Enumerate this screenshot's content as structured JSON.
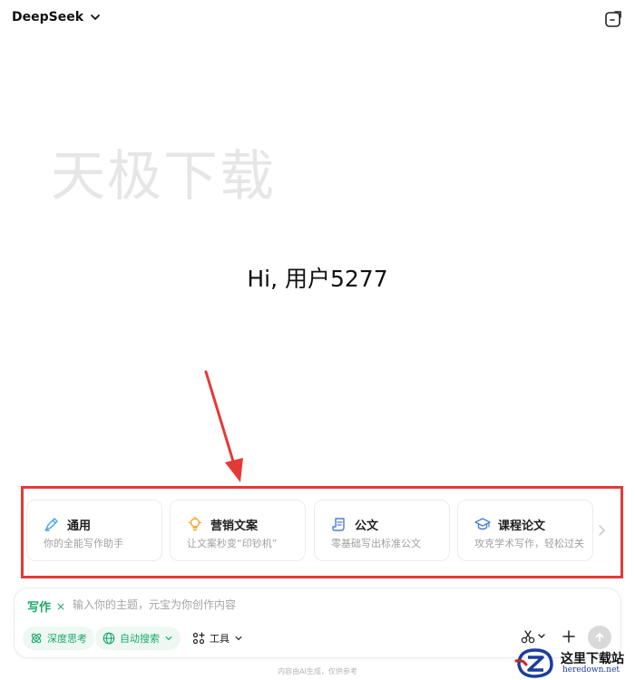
{
  "header": {
    "app_name": "DeepSeek"
  },
  "watermark": "天极下载",
  "greeting": "Hi, 用户5277",
  "cards": [
    {
      "title": "通用",
      "subtitle": "你的全能写作助手",
      "icon": "pen-icon"
    },
    {
      "title": "营销文案",
      "subtitle": "让文案秒变“印钞机”",
      "icon": "lightbulb-icon"
    },
    {
      "title": "公文",
      "subtitle": "零基础写出标准公文",
      "icon": "scroll-icon"
    },
    {
      "title": "课程论文",
      "subtitle": "攻克学术写作，轻松过关",
      "icon": "graduation-cap-icon"
    }
  ],
  "composer": {
    "mode_label": "写作",
    "mode_close": "×",
    "placeholder": "输入你的主题，元宝为你创作内容",
    "value": "",
    "deep_think_label": "深度思考",
    "auto_search_label": "自动搜索",
    "tools_label": "工具"
  },
  "disclaimer": "内容由AI生成，仅供参考",
  "logo": {
    "title": "这里下载站",
    "url": "heredown.net"
  },
  "colors": {
    "accent_green": "#1aa86b",
    "highlight_red": "#e53935",
    "watermark_gray": "#e6e6e6"
  }
}
